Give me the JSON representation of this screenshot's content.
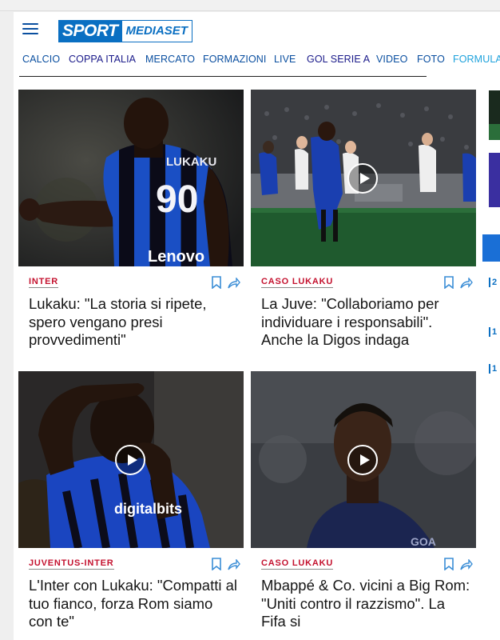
{
  "logo": {
    "sport": "SPORT",
    "mediaset": "MEDIASET"
  },
  "nav": {
    "items": [
      {
        "label": "CALCIO",
        "color": "#0a4fa0"
      },
      {
        "label": "COPPA ITALIA",
        "color": "#1a1a8a"
      },
      {
        "label": "MERCATO",
        "color": "#0a4fa0"
      },
      {
        "label": "FORMAZIONI",
        "color": "#0a4fa0"
      },
      {
        "label": "LIVE",
        "color": "#0a4fa0"
      },
      {
        "label": "GOL SERIE A",
        "color": "#1a1a8a"
      },
      {
        "label": "VIDEO",
        "color": "#0a4fa0"
      },
      {
        "label": "FOTO",
        "color": "#0a4fa0"
      },
      {
        "label": "FORMULA",
        "color": "#1ea2dc"
      }
    ]
  },
  "articles": [
    {
      "tag": "INTER",
      "title": "Lukaku: \"La storia si ripete, spero vengano presi provvedimenti\"",
      "has_video": false,
      "jersey_number": "90",
      "jersey_name": "LUKAKU",
      "sponsor": "Lenovo"
    },
    {
      "tag": "CASO LUKAKU",
      "title": "La Juve: \"Collaboriamo per individuare i responsabili\". Anche la Digos indaga",
      "has_video": true
    },
    {
      "tag": "JUVENTUS-INTER",
      "title": "L'Inter con Lukaku: \"Compatti al tuo fianco, forza Rom siamo con te\"",
      "has_video": true,
      "sponsor": "digitalbits"
    },
    {
      "tag": "CASO LUKAKU",
      "title": "Mbappé & Co. vicini a Big Rom: \"Uniti contro il razzismo\". La Fifa si",
      "has_video": true
    }
  ],
  "sidebar": {
    "badges": [
      "2",
      "1",
      "1"
    ]
  },
  "colors": {
    "brand": "#0a6fc2",
    "tag": "#c4122f",
    "nav": "#0a4fa0"
  }
}
